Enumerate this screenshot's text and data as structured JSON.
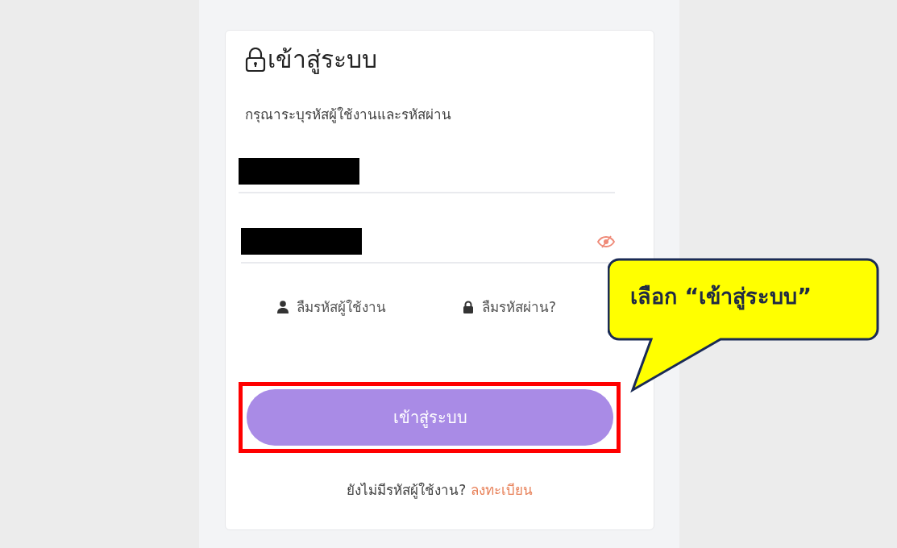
{
  "login_card": {
    "title": "เข้าสู่ระบบ",
    "instruction": "กรุณาระบุรหัสผู้ใช้งานและรหัสผ่าน",
    "fields": [
      {
        "kind": "username",
        "redacted": true
      },
      {
        "kind": "password",
        "redacted": true
      }
    ],
    "help_links": [
      {
        "kind": "username",
        "label": "ลืมรหัสผู้ใช้งาน"
      },
      {
        "kind": "password",
        "label": "ลืมรหัสผ่าน?"
      }
    ],
    "submit_button": {
      "label": "เข้าสู่ระบบ",
      "highlighted": true
    },
    "signup_prompt": "ยังไม่มีรหัสผู้ใช้งาน?",
    "signup_link": "ลงทะเบียน"
  },
  "callout": {
    "text": "เลือก “เข้าสู่ระบบ”"
  }
}
